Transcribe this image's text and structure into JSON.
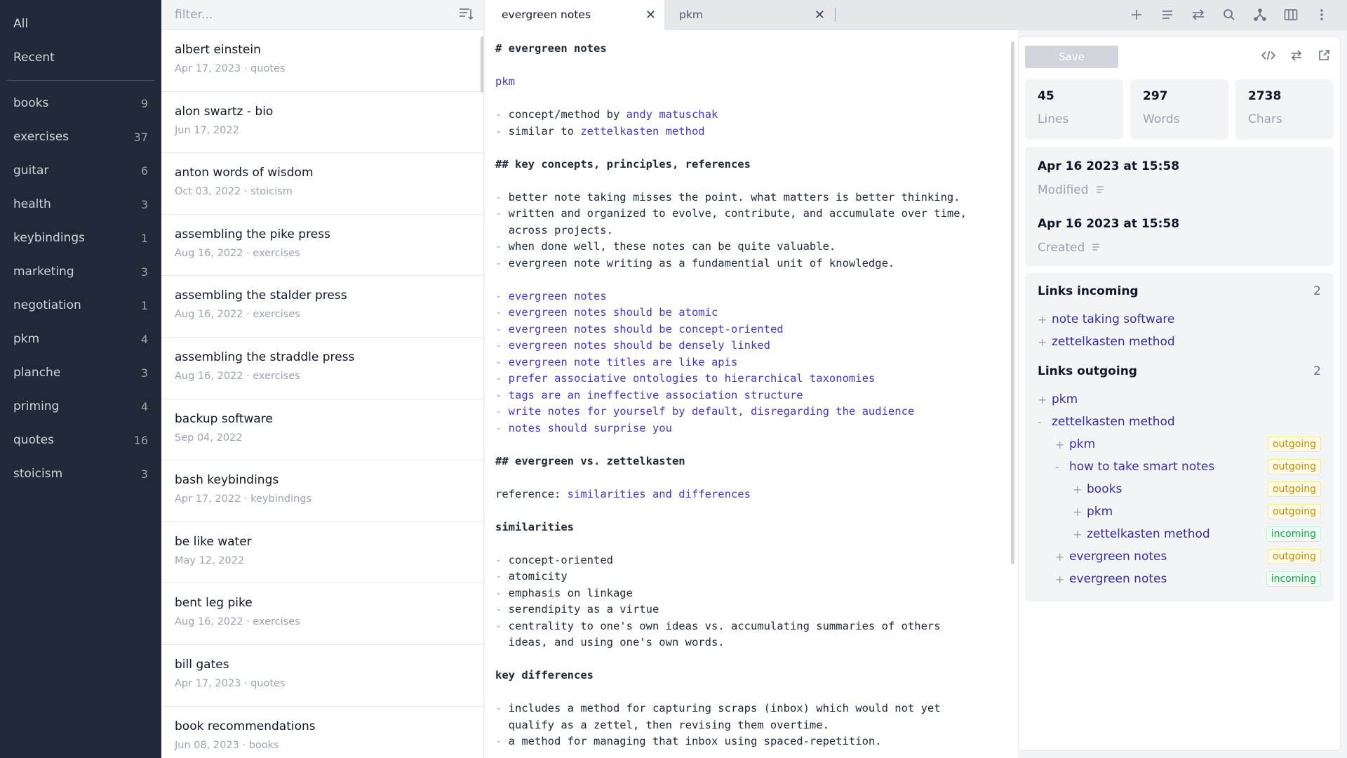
{
  "sidebar": {
    "top": [
      "All",
      "Recent"
    ],
    "tags": [
      {
        "label": "books",
        "count": "9"
      },
      {
        "label": "exercises",
        "count": "37"
      },
      {
        "label": "guitar",
        "count": "6"
      },
      {
        "label": "health",
        "count": "3"
      },
      {
        "label": "keybindings",
        "count": "1"
      },
      {
        "label": "marketing",
        "count": "3"
      },
      {
        "label": "negotiation",
        "count": "1"
      },
      {
        "label": "pkm",
        "count": "4"
      },
      {
        "label": "planche",
        "count": "3"
      },
      {
        "label": "priming",
        "count": "4"
      },
      {
        "label": "quotes",
        "count": "16"
      },
      {
        "label": "stoicism",
        "count": "3"
      }
    ]
  },
  "notelist": {
    "filter_placeholder": "filter...",
    "notes": [
      {
        "title": "albert einstein",
        "meta": "Apr 17, 2023 · quotes"
      },
      {
        "title": "alon swartz - bio",
        "meta": "Jun 17, 2022"
      },
      {
        "title": "anton words of wisdom",
        "meta": "Oct 03, 2022 · stoicism"
      },
      {
        "title": "assembling the pike press",
        "meta": "Aug 16, 2022 · exercises"
      },
      {
        "title": "assembling the stalder press",
        "meta": "Aug 16, 2022 · exercises"
      },
      {
        "title": "assembling the straddle press",
        "meta": "Aug 16, 2022 · exercises"
      },
      {
        "title": "backup software",
        "meta": "Sep 04, 2022"
      },
      {
        "title": "bash keybindings",
        "meta": "Apr 17, 2022 · keybindings"
      },
      {
        "title": "be like water",
        "meta": "May 12, 2022"
      },
      {
        "title": "bent leg pike",
        "meta": "Aug 16, 2022 · exercises"
      },
      {
        "title": "bill gates",
        "meta": "Apr 17, 2023 · quotes"
      },
      {
        "title": "book recommendations",
        "meta": "Jun 08, 2023 · books"
      }
    ]
  },
  "tabs": [
    {
      "label": "evergreen notes",
      "close": "✕"
    },
    {
      "label": "pkm",
      "close": "✕"
    }
  ],
  "toolbar_icons": [
    "plus-icon",
    "list-icon",
    "swap-icon",
    "search-icon",
    "graph-icon",
    "columns-icon",
    "more-icon"
  ],
  "editor": {
    "lines": [
      {
        "segs": [
          {
            "t": "# evergreen notes",
            "c": "h"
          }
        ]
      },
      {
        "segs": []
      },
      {
        "segs": [
          {
            "t": "pkm",
            "c": "lk"
          }
        ]
      },
      {
        "segs": []
      },
      {
        "segs": [
          {
            "t": "- ",
            "c": "dash"
          },
          {
            "t": "concept/method by "
          },
          {
            "t": "andy matuschak",
            "c": "lk"
          }
        ]
      },
      {
        "segs": [
          {
            "t": "- ",
            "c": "dash"
          },
          {
            "t": "similar to "
          },
          {
            "t": "zettelkasten method",
            "c": "lk"
          }
        ]
      },
      {
        "segs": []
      },
      {
        "segs": [
          {
            "t": "## key concepts, principles, references",
            "c": "h"
          }
        ]
      },
      {
        "segs": []
      },
      {
        "segs": [
          {
            "t": "- ",
            "c": "dash"
          },
          {
            "t": "better note taking misses the point. what matters is better thinking."
          }
        ]
      },
      {
        "segs": [
          {
            "t": "- ",
            "c": "dash"
          },
          {
            "t": "written and organized to evolve, contribute, and accumulate over time,"
          }
        ]
      },
      {
        "segs": [
          {
            "t": "  across projects."
          }
        ]
      },
      {
        "segs": [
          {
            "t": "- ",
            "c": "dash"
          },
          {
            "t": "when done well, these notes can be quite valuable."
          }
        ]
      },
      {
        "segs": [
          {
            "t": "- ",
            "c": "dash"
          },
          {
            "t": "evergreen note writing as a fundamential unit of knowledge."
          }
        ]
      },
      {
        "segs": []
      },
      {
        "segs": [
          {
            "t": "- ",
            "c": "dash"
          },
          {
            "t": "evergreen notes",
            "c": "lk"
          }
        ]
      },
      {
        "segs": [
          {
            "t": "- ",
            "c": "dash"
          },
          {
            "t": "evergreen notes should be atomic",
            "c": "lk"
          }
        ]
      },
      {
        "segs": [
          {
            "t": "- ",
            "c": "dash"
          },
          {
            "t": "evergreen notes should be concept-oriented",
            "c": "lk"
          }
        ]
      },
      {
        "segs": [
          {
            "t": "- ",
            "c": "dash"
          },
          {
            "t": "evergreen notes should be densely linked",
            "c": "lk"
          }
        ]
      },
      {
        "segs": [
          {
            "t": "- ",
            "c": "dash"
          },
          {
            "t": "evergreen note titles are like apis",
            "c": "lk"
          }
        ]
      },
      {
        "segs": [
          {
            "t": "- ",
            "c": "dash"
          },
          {
            "t": "prefer associative ontologies to hierarchical taxonomies",
            "c": "lk"
          }
        ]
      },
      {
        "segs": [
          {
            "t": "- ",
            "c": "dash"
          },
          {
            "t": "tags are an ineffective association structure",
            "c": "lk"
          }
        ]
      },
      {
        "segs": [
          {
            "t": "- ",
            "c": "dash"
          },
          {
            "t": "write notes for yourself by default, disregarding the audience",
            "c": "lk"
          }
        ]
      },
      {
        "segs": [
          {
            "t": "- ",
            "c": "dash"
          },
          {
            "t": "notes should surprise you",
            "c": "lk"
          }
        ]
      },
      {
        "segs": []
      },
      {
        "segs": [
          {
            "t": "## evergreen vs. zettelkasten",
            "c": "h"
          }
        ]
      },
      {
        "segs": []
      },
      {
        "segs": [
          {
            "t": "reference: "
          },
          {
            "t": "similarities and differences",
            "c": "lk"
          }
        ]
      },
      {
        "segs": []
      },
      {
        "segs": [
          {
            "t": "similarities",
            "c": "h"
          }
        ]
      },
      {
        "segs": []
      },
      {
        "segs": [
          {
            "t": "- ",
            "c": "dash"
          },
          {
            "t": "concept-oriented"
          }
        ]
      },
      {
        "segs": [
          {
            "t": "- ",
            "c": "dash"
          },
          {
            "t": "atomicity"
          }
        ]
      },
      {
        "segs": [
          {
            "t": "- ",
            "c": "dash"
          },
          {
            "t": "emphasis on linkage"
          }
        ]
      },
      {
        "segs": [
          {
            "t": "- ",
            "c": "dash"
          },
          {
            "t": "serendipity as a virtue"
          }
        ]
      },
      {
        "segs": [
          {
            "t": "- ",
            "c": "dash"
          },
          {
            "t": "centrality to one's own ideas vs. accumulating summaries of others"
          }
        ]
      },
      {
        "segs": [
          {
            "t": "  ideas, and using one's own words."
          }
        ]
      },
      {
        "segs": []
      },
      {
        "segs": [
          {
            "t": "key differences",
            "c": "h"
          }
        ]
      },
      {
        "segs": []
      },
      {
        "segs": [
          {
            "t": "- ",
            "c": "dash"
          },
          {
            "t": "includes a method for capturing scraps (inbox) which would not yet"
          }
        ]
      },
      {
        "segs": [
          {
            "t": "  qualify as a zettel, then revising them overtime."
          }
        ]
      },
      {
        "segs": [
          {
            "t": "- ",
            "c": "dash"
          },
          {
            "t": "a method for managing that inbox using spaced-repetition."
          }
        ]
      }
    ]
  },
  "info": {
    "save_label": "Save",
    "stats": [
      {
        "value": "45",
        "label": "Lines"
      },
      {
        "value": "297",
        "label": "Words"
      },
      {
        "value": "2738",
        "label": "Chars"
      }
    ],
    "modified": {
      "value": "Apr 16 2023 at 15:58",
      "label": "Modified"
    },
    "created": {
      "value": "Apr 16 2023 at 15:58",
      "label": "Created"
    },
    "links_incoming": {
      "title": "Links incoming",
      "count": "2",
      "items": [
        {
          "sign": "+",
          "label": "note taking software"
        },
        {
          "sign": "+",
          "label": "zettelkasten method"
        }
      ]
    },
    "links_outgoing": {
      "title": "Links outgoing",
      "count": "2",
      "items": [
        {
          "sign": "+",
          "label": "pkm",
          "level": 0,
          "badge": ""
        },
        {
          "sign": "-",
          "label": "zettelkasten method",
          "level": 0,
          "badge": ""
        },
        {
          "sign": "+",
          "label": "pkm",
          "level": 1,
          "badge": "outgoing"
        },
        {
          "sign": "-",
          "label": "how to take smart notes",
          "level": 1,
          "badge": "outgoing"
        },
        {
          "sign": "+",
          "label": "books",
          "level": 2,
          "badge": "outgoing"
        },
        {
          "sign": "+",
          "label": "pkm",
          "level": 2,
          "badge": "outgoing"
        },
        {
          "sign": "+",
          "label": "zettelkasten method",
          "level": 2,
          "badge": "incoming"
        },
        {
          "sign": "+",
          "label": "evergreen notes",
          "level": 1,
          "badge": "outgoing"
        },
        {
          "sign": "+",
          "label": "evergreen notes",
          "level": 1,
          "badge": "incoming"
        }
      ]
    }
  }
}
